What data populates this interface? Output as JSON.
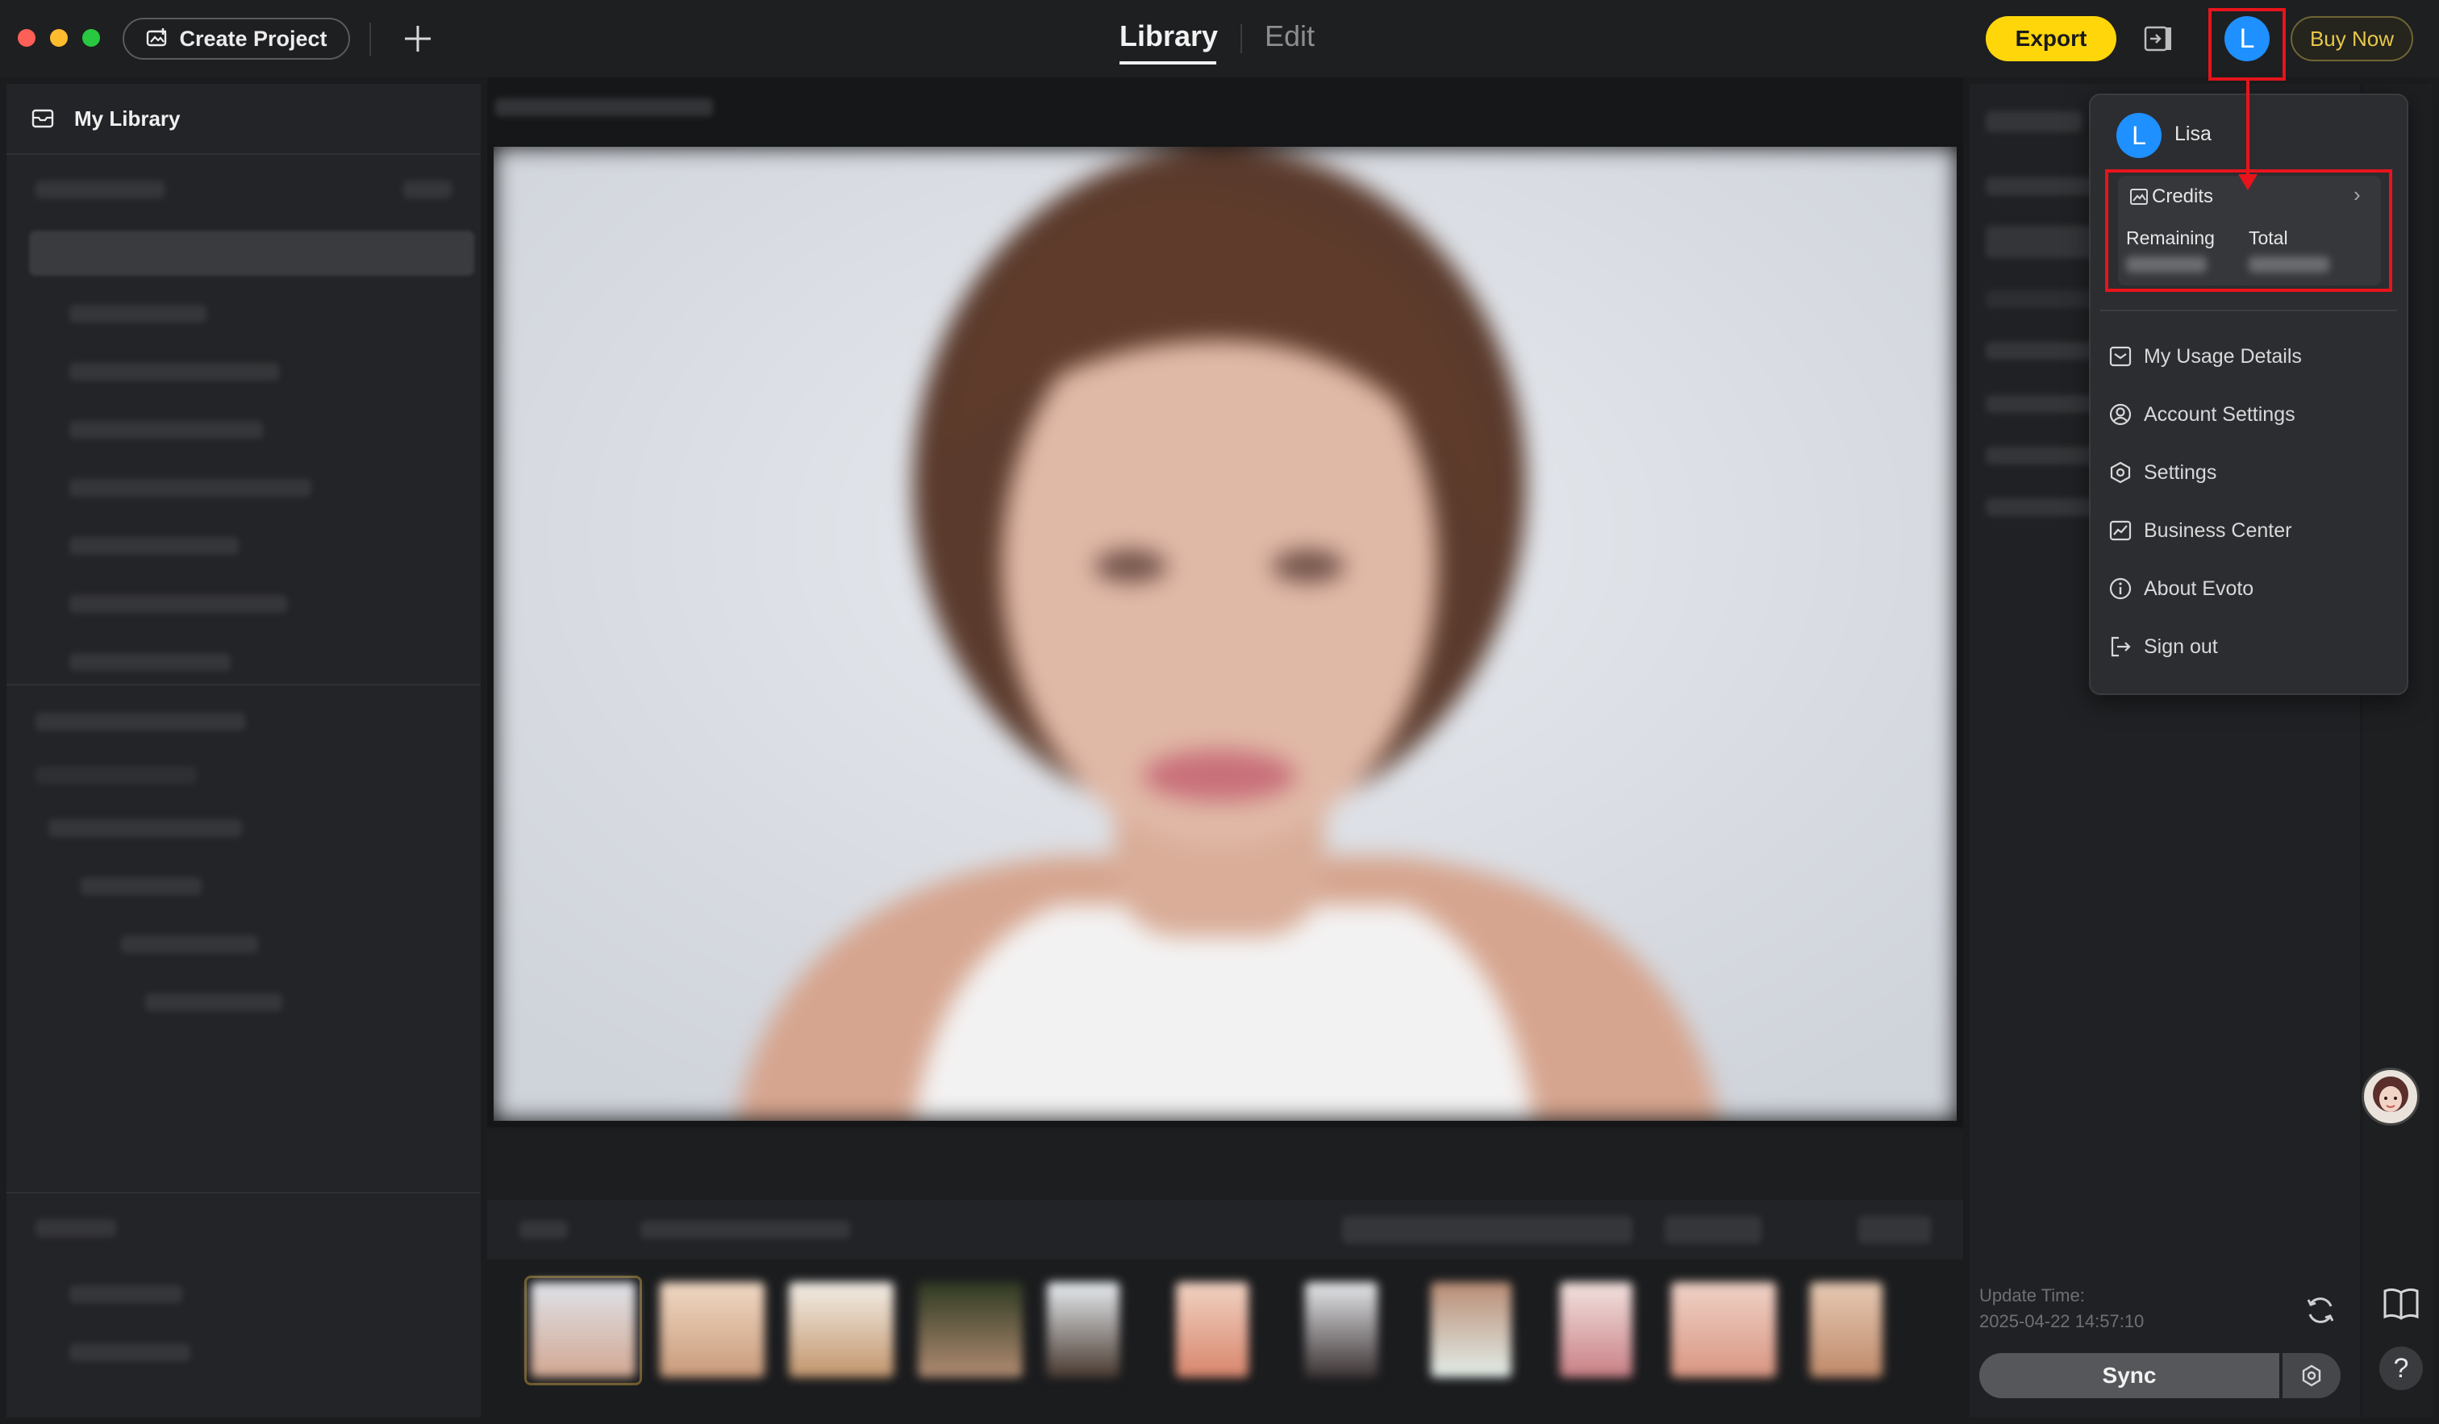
{
  "titlebar": {
    "create_project_label": "Create Project",
    "tabs": [
      {
        "label": "Library",
        "active": true
      },
      {
        "label": "Edit",
        "active": false
      }
    ],
    "export_label": "Export",
    "avatar_initial": "L",
    "buy_now_label": "Buy Now"
  },
  "sidebar": {
    "my_library_label": "My Library"
  },
  "account_menu": {
    "user_initial": "L",
    "user_name": "Lisa",
    "credits": {
      "label": "Credits",
      "remaining_label": "Remaining",
      "total_label": "Total"
    },
    "items": [
      {
        "label": "My Usage Details",
        "icon": "usage-icon"
      },
      {
        "label": "Account Settings",
        "icon": "account-icon"
      },
      {
        "label": "Settings",
        "icon": "settings-icon"
      },
      {
        "label": "Business Center",
        "icon": "business-icon"
      },
      {
        "label": "About Evoto",
        "icon": "info-icon"
      },
      {
        "label": "Sign out",
        "icon": "sign-out-icon"
      }
    ]
  },
  "right_panel": {
    "update_time_label": "Update Time:",
    "update_time_value": "2025-04-22 14:57:10",
    "sync_label": "Sync"
  },
  "colors": {
    "accent_yellow": "#ffd60a",
    "avatar_blue": "#1e90ff",
    "annotation_red": "#e8141c"
  }
}
